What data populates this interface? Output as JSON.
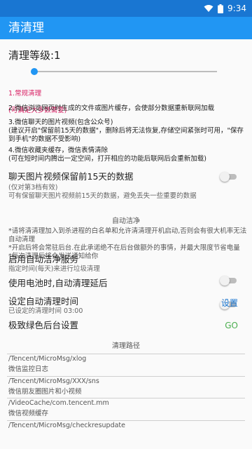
{
  "status": {
    "time": "9:34"
  },
  "appbar": {
    "title": "清清理"
  },
  "level": {
    "label": "清理等级:1",
    "value": 1
  },
  "items": [
    {
      "line1": "1.常规清理",
      "line2": "(可满足大多数需要)"
    },
    {
      "text": "2.微信浏览网页时生成的文件或图片缓存，会使部分数据重新联网加载"
    },
    {
      "text": "3.微信聊天的图片视频(包含公众号)\n(建议开启\"保留前15天的数据\"，删除后将无法恢复,存储空间紧张时可用，\"保存到手机\"的数据不受影响)"
    },
    {
      "text": "4.微信收藏夹缓存，微信表情清除\n(可在短时间内腾出一定空间，打开相应的功能后联网后会重新加载)"
    }
  ],
  "keep15": {
    "title": "聊天图片视频保留前15天的数据",
    "sub": "(仅对第3档有效)\n可有保留聊天图片视频前15天的数据，避免丢失一些重要的数据",
    "enabled": false
  },
  "auto": {
    "section_title": "自动洁净",
    "notes": "*请将清清理加入到杀进程的白名单和允许清清理开机启动,否则会有很大机率无法自动清理\n *开启后将会常驻后台.在此承诺绝不在后台做额外的事情，并最大限度节省电量\n *每次清理后将会发送通知给你",
    "service_title": "启用自动洁净服务",
    "service_sub": "指定时间(每天)来进行垃圾清理",
    "service_enabled": false,
    "battery_title": "使用电池时,自动清理延后",
    "battery_enabled": false,
    "time_title": "设定自动清理时间",
    "time_sub": "已设定的清理时间 03:00",
    "time_action": "设置",
    "green_title": "极致绿色后台设置",
    "green_action": "GO"
  },
  "paths": {
    "section_title": "清理路径",
    "list": [
      {
        "path": "/Tencent/MicroMsg/xlog",
        "desc": "微信监控日志"
      },
      {
        "path": "/Tencent/MicroMsg/XXX/sns",
        "desc": "微信朋友圈图片和小视频"
      },
      {
        "path": "/VideoCache/com.tencent.mm",
        "desc": "微信视频缓存"
      },
      {
        "path": "/Tencent/MicroMsg/checkresupdate",
        "desc": ""
      }
    ]
  },
  "colors": {
    "appbar": "#2196f3",
    "statusbar": "#1976d2",
    "accent_red": "#d81b60",
    "link": "#1976d2",
    "go": "#4caf50"
  }
}
